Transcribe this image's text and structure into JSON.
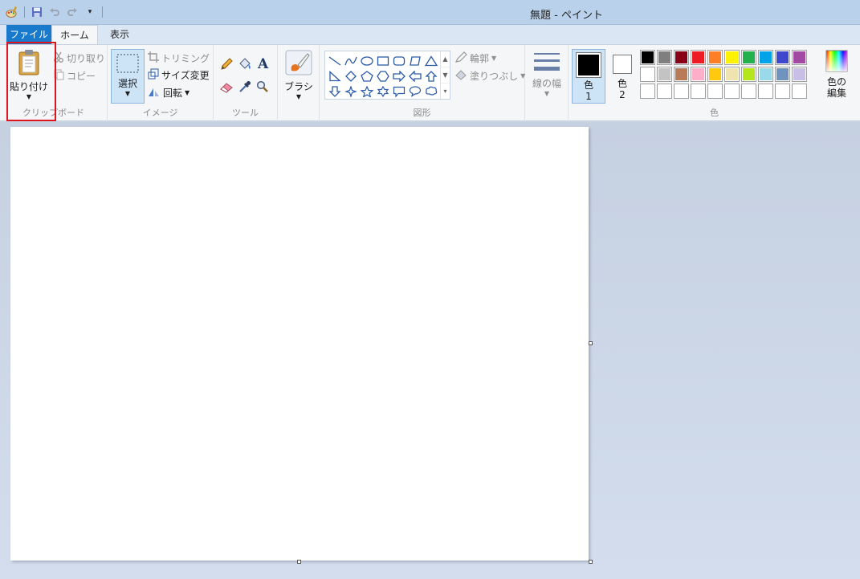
{
  "window": {
    "title": "無題 - ペイント"
  },
  "tabs": {
    "file": "ファイル",
    "home": "ホーム",
    "view": "表示"
  },
  "clipboard": {
    "paste": "貼り付け",
    "cut": "切り取り",
    "copy": "コピー",
    "label": "クリップボード"
  },
  "image": {
    "select": "選択",
    "crop": "トリミング",
    "resize": "サイズ変更",
    "rotate": "回転",
    "label": "イメージ"
  },
  "tools": {
    "label": "ツール",
    "text_tool": "A"
  },
  "brushes": {
    "label": "ブラシ"
  },
  "shapes": {
    "label": "図形",
    "outline": "輪郭",
    "fill": "塗りつぶし"
  },
  "size": {
    "label": "線の幅"
  },
  "colors": {
    "color1": "色",
    "color1_num": "1",
    "color2": "色",
    "color2_num": "2",
    "edit_line1": "色の",
    "edit_line2": "編集",
    "label": "色",
    "color1_value": "#000000",
    "color2_value": "#ffffff",
    "palette_row1": [
      "#000000",
      "#7f7f7f",
      "#880015",
      "#ed1c24",
      "#ff7f27",
      "#fff200",
      "#22b14c",
      "#00a2e8",
      "#3f48cc",
      "#a349a4"
    ],
    "palette_row2": [
      "#ffffff",
      "#c3c3c3",
      "#b97a57",
      "#ffaec9",
      "#ffc90e",
      "#efe4b0",
      "#b5e61d",
      "#99d9ea",
      "#7092be",
      "#c8bfe7"
    ],
    "palette_row3": [
      "#ffffff",
      "#ffffff",
      "#ffffff",
      "#ffffff",
      "#ffffff",
      "#ffffff",
      "#ffffff",
      "#ffffff",
      "#ffffff",
      "#ffffff"
    ]
  }
}
